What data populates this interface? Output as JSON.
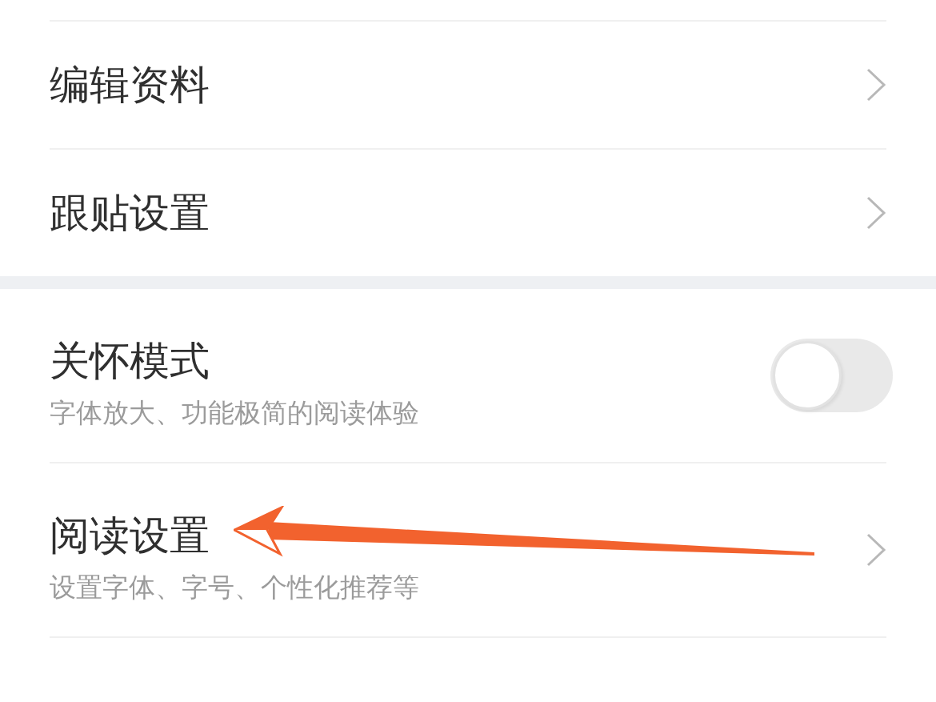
{
  "groups": [
    {
      "items": [
        {
          "kind": "link",
          "title": "编辑资料"
        },
        {
          "kind": "link",
          "title": "跟贴设置"
        }
      ]
    },
    {
      "items": [
        {
          "kind": "switch",
          "title": "关怀模式",
          "subtitle": "字体放大、功能极简的阅读体验",
          "on": false
        },
        {
          "kind": "link",
          "title": "阅读设置",
          "subtitle": "设置字体、字号、个性化推荐等"
        }
      ]
    }
  ]
}
